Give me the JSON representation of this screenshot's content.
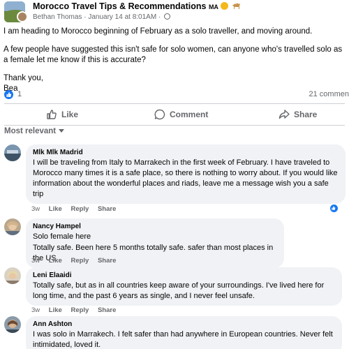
{
  "post": {
    "group_name": "Morocco Travel Tips & Recommendations",
    "group_badge": "MA",
    "author": "Bethan Thomas",
    "separator": "·",
    "timestamp": "January 14 at 8:01AM",
    "meta_dot": "·",
    "paragraphs": [
      "I am heading to Morocco beginning of February as a solo traveller, and moving around.",
      "A few people have suggested this isn't safe for solo women, can anyone who's travelled solo as a female let me know if this is accurate?"
    ],
    "signoff_line1": "Thank you,",
    "signoff_line2": "Bea",
    "like_count": "1",
    "comment_count": "21 commen"
  },
  "actions": {
    "like": "Like",
    "comment": "Comment",
    "share": "Share"
  },
  "sort_label": "Most relevant",
  "comments": [
    {
      "author": "Mlk Mlk Madrid",
      "text": "I will be traveling from Italy to Marrakech in the first week of February. I have traveled to Morocco many times it is a safe place, so there is nothing to worry about. If you would like information about the wonderful places and riads, leave me a message wish you a safe trip",
      "time": "3w",
      "like": "Like",
      "reply": "Reply",
      "share": "Share"
    },
    {
      "author": "Nancy Hampel",
      "text_line1": "Solo female here",
      "text_line2": "Totally safe. Been here 5 months totally safe. safer than most places in the US",
      "time": "3w",
      "like": "Like",
      "reply": "Reply",
      "share": "Share"
    },
    {
      "author": "Leni Elaaidi",
      "text": "Totally safe, but as in all countries keep aware of your surroundings. I've lived here for long time, and the past 6 years as single, and I never feel unsafe.",
      "time": "3w",
      "like": "Like",
      "reply": "Reply",
      "share": "Share"
    },
    {
      "author": "Ann Ashton",
      "text": "I was solo in Marrakech. I felt safer than had anywhere in European countries. Never felt intimidated, loved it."
    }
  ],
  "icons": {
    "like": "thumbs-up-icon",
    "comment": "speech-bubble-icon",
    "share": "share-arrow-icon",
    "privacy": "globe-icon"
  },
  "colors": {
    "facebook_blue": "#1877f2",
    "muted_text": "#65676b",
    "bubble_bg": "#f0f2f5"
  }
}
